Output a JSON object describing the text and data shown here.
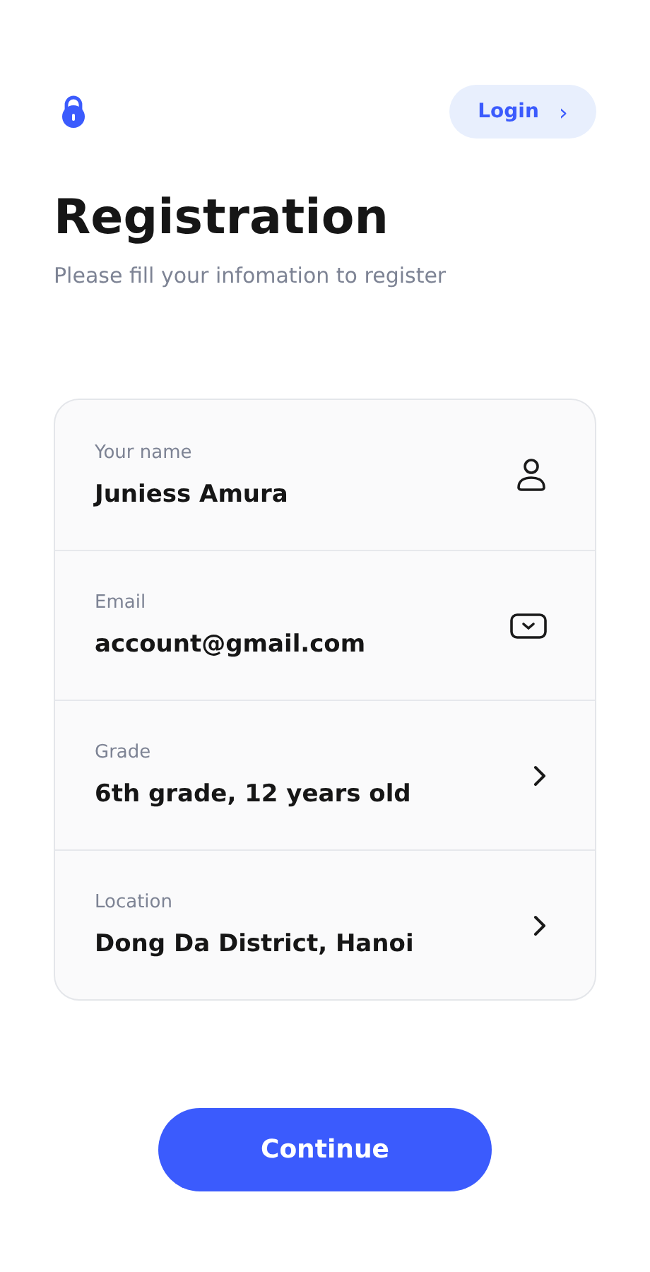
{
  "header": {
    "login_button": {
      "label": "Login",
      "chevron": "›"
    }
  },
  "title": "Registration",
  "subtitle": "Please fill your infomation to register",
  "fields": [
    {
      "label": "Your name",
      "value": "Juniess Amura",
      "kind": "person"
    },
    {
      "label": "Email",
      "value": "account@gmail.com",
      "kind": "mail"
    },
    {
      "label": "Grade",
      "value": "6th grade, 12 years old",
      "kind": "select"
    },
    {
      "label": "Location",
      "value": "Dong Da District, Hanoi",
      "kind": "select"
    }
  ],
  "continue_button": {
    "label": "Continue"
  }
}
